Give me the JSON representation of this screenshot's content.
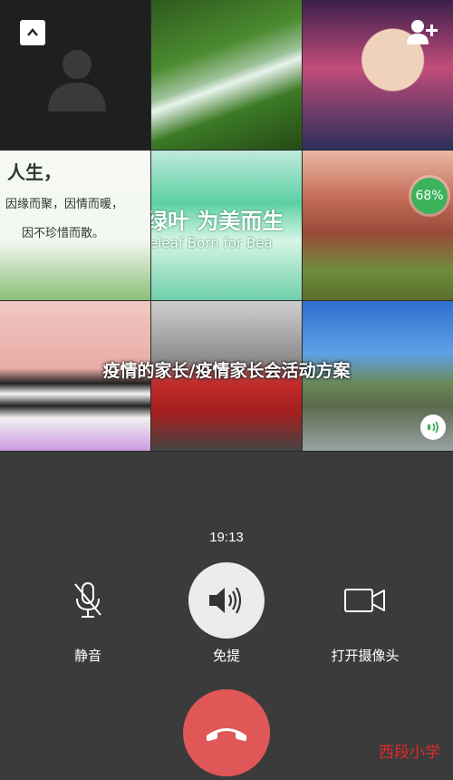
{
  "grid": {
    "cell4_text": {
      "line1": "人生，",
      "line2": "因缘而聚，因情而暖，",
      "line3": "因不珍惜而散。"
    },
    "cell5_text": {
      "line1": "绿叶 为美而生",
      "line2": "eleaf Born for Bea"
    },
    "cell6_badge": "68%"
  },
  "headline": "疫情的家长/疫情家长会活动方案",
  "call": {
    "timer": "19:13",
    "controls": {
      "mute_label": "静音",
      "speaker_label": "免提",
      "camera_label": "打开摄像头"
    }
  },
  "watermark": "西段小学",
  "colors": {
    "hangup": "#e05757",
    "badge": "#3bb35a",
    "background": "#3b3b3b"
  }
}
